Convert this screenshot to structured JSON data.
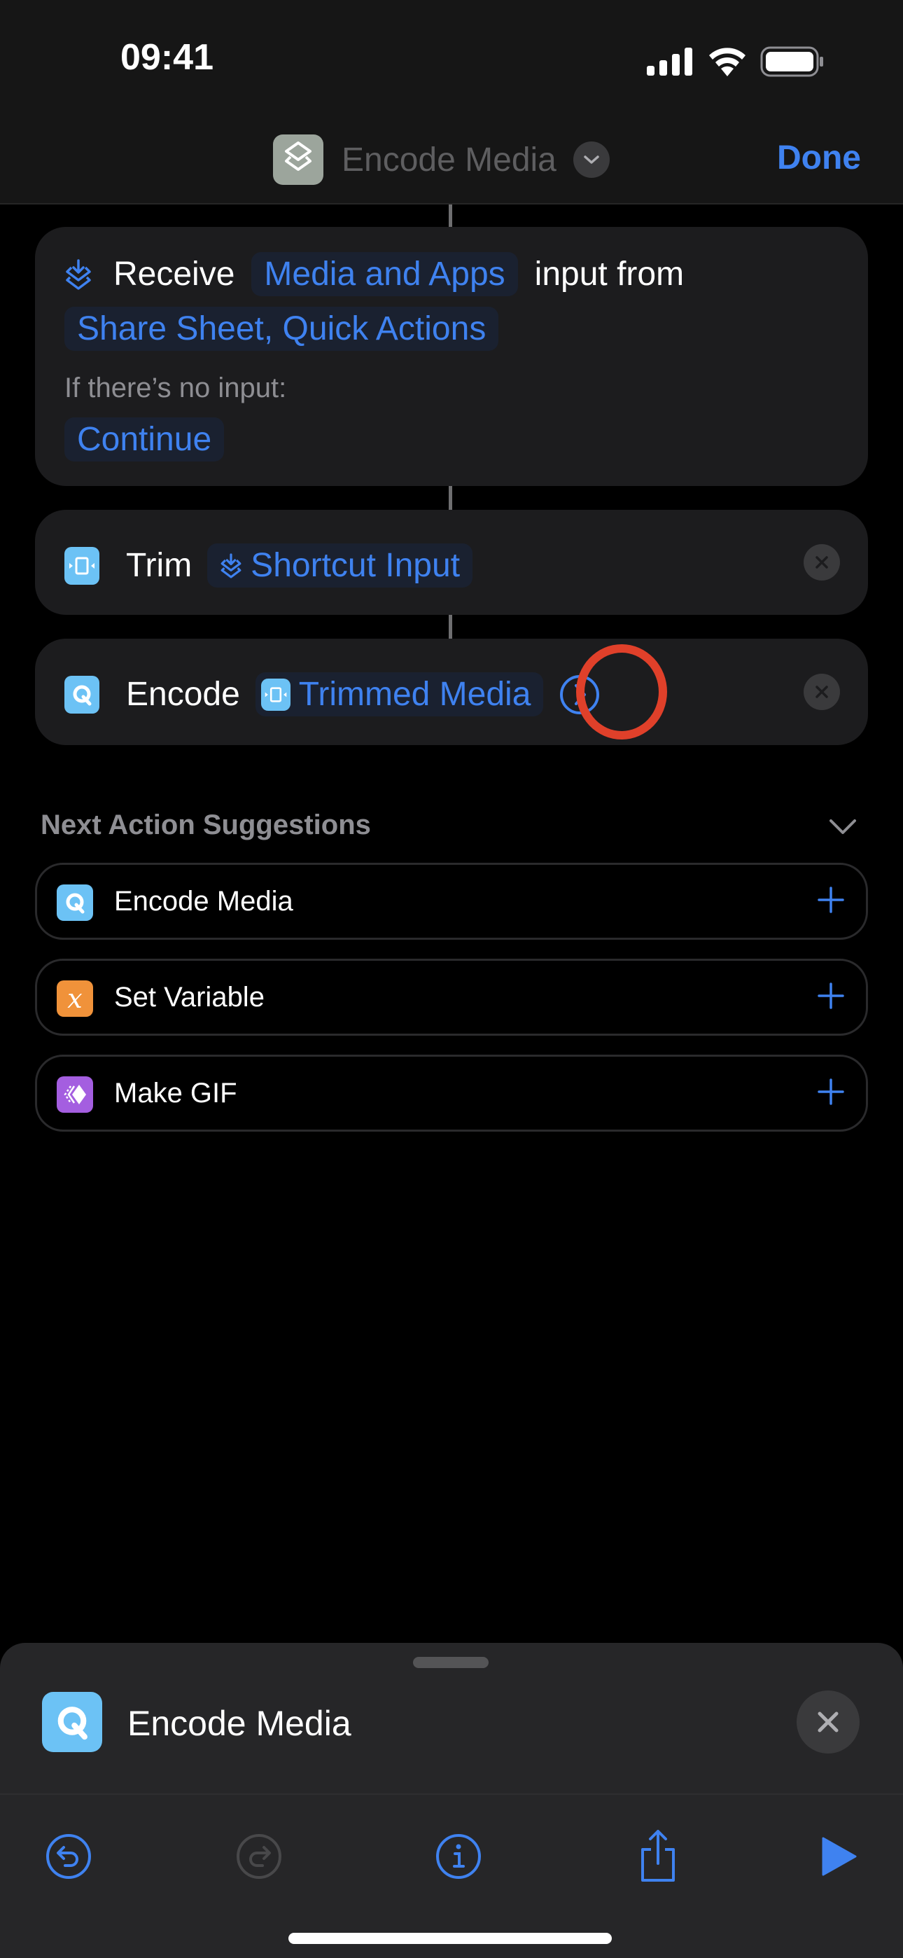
{
  "status_bar": {
    "time": "09:41",
    "icons": [
      "cellular-signal-icon",
      "wifi-icon",
      "battery-icon"
    ]
  },
  "nav": {
    "title": "Encode Media",
    "app_icon": "shortcuts-layers-icon",
    "title_menu_icon": "chevron-down-icon",
    "done_label": "Done"
  },
  "actions": [
    {
      "id": "receive",
      "icon": "shortcut-input-icon",
      "verb": "Receive",
      "type_token": "Media and Apps",
      "connector_text": "input from",
      "source_token": "Share Sheet, Quick Actions",
      "fallback_label": "If there’s no input:",
      "fallback_token": "Continue"
    },
    {
      "id": "trim",
      "icon": "trim-media-icon",
      "verb": "Trim",
      "input_token": "Shortcut Input",
      "input_token_icon": "shortcut-input-icon",
      "remove_icon": "remove-icon"
    },
    {
      "id": "encode",
      "icon": "encode-media-icon",
      "verb": "Encode",
      "input_token": "Trimmed Media",
      "input_token_icon": "trim-media-icon",
      "expand_icon": "chevron-right-circle-icon",
      "remove_icon": "remove-icon",
      "highlighted": true
    }
  ],
  "suggestions": {
    "header": "Next Action Suggestions",
    "collapse_icon": "chevron-down-icon",
    "items": [
      {
        "label": "Encode Media",
        "icon": "encode-media-icon",
        "color": "#6cc2f5"
      },
      {
        "label": "Set Variable",
        "icon": "variable-x-icon",
        "color": "#f0923a"
      },
      {
        "label": "Make GIF",
        "icon": "make-gif-icon",
        "color": "#a45ee0"
      }
    ]
  },
  "bottom_sheet": {
    "title": "Encode Media",
    "icon": "encode-media-icon",
    "close_icon": "close-icon",
    "toolbar": [
      {
        "name": "undo",
        "icon": "undo-icon",
        "enabled": true
      },
      {
        "name": "redo",
        "icon": "redo-icon",
        "enabled": false
      },
      {
        "name": "info",
        "icon": "info-icon",
        "enabled": true
      },
      {
        "name": "share",
        "icon": "share-icon",
        "enabled": true
      },
      {
        "name": "run",
        "icon": "play-icon",
        "enabled": true
      }
    ]
  },
  "colors": {
    "accent": "#3f82f0",
    "highlight_ring": "#e0402a",
    "card_bg": "#1c1c1e"
  }
}
